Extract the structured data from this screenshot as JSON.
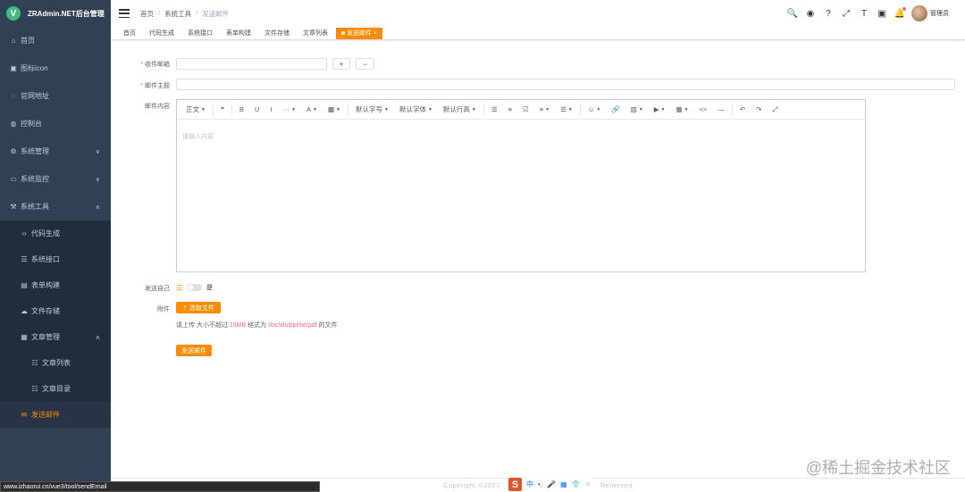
{
  "app": {
    "logo_letter": "V",
    "title": "ZRAdmin.NET后台管理"
  },
  "sidebar": {
    "items": [
      {
        "icon": "⌂",
        "label": "首页"
      },
      {
        "icon": "▣",
        "label": "图标icon"
      },
      {
        "icon": "◌",
        "label": "官网地址"
      },
      {
        "icon": "◍",
        "label": "控制台"
      },
      {
        "icon": "⚙",
        "label": "系统管理",
        "chevron": "∨"
      },
      {
        "icon": "▭",
        "label": "系统监控",
        "chevron": "∨"
      },
      {
        "icon": "⚒",
        "label": "系统工具",
        "chevron": "∧"
      }
    ],
    "tools_sub": [
      {
        "icon": "‹›",
        "label": "代码生成"
      },
      {
        "icon": "☰",
        "label": "系统接口"
      },
      {
        "icon": "▤",
        "label": "表单构建"
      },
      {
        "icon": "☁",
        "label": "文件存储"
      },
      {
        "icon": "▦",
        "label": "文章管理",
        "chevron": "∧"
      }
    ],
    "article_sub": [
      {
        "icon": "☷",
        "label": "文章列表"
      },
      {
        "icon": "☷",
        "label": "文章目录"
      }
    ],
    "active": {
      "icon": "✉",
      "label": "发送邮件"
    }
  },
  "header": {
    "breadcrumb": [
      "首页",
      "系统工具",
      "发送邮件"
    ],
    "separator": "/",
    "icons": [
      "🔍",
      "◉",
      "?",
      "⤢",
      "T",
      "▣",
      "🔔"
    ],
    "username": "管理员"
  },
  "tags": [
    "首页",
    "代码生成",
    "系统接口",
    "表单构建",
    "文件存储",
    "文章列表"
  ],
  "active_tag": "发送邮件",
  "active_tag_close": "×",
  "form": {
    "to_label": "收件邮箱",
    "add_label": "+",
    "remove_label": "−",
    "subject_label": "邮件主题",
    "content_label": "邮件内容",
    "editor_placeholder": "请输入内容",
    "send_self_label": "发送自己",
    "send_self_icon": "☰",
    "send_self_value": "是",
    "attach_label": "附件",
    "upload_label": "⇡ 选取文件",
    "tip_prefix": "请上传 大小不超过 ",
    "tip_size": "15MB",
    "tip_mid": " 格式为 ",
    "tip_types": "doc/xls/ppt/txt/pdf",
    "tip_suffix": " 的文件",
    "send_label": "发送邮件"
  },
  "toolbar": [
    {
      "label": "正文",
      "caret": true
    },
    {
      "sep": true
    },
    {
      "label": "❝"
    },
    {
      "sep": true
    },
    {
      "label": "B"
    },
    {
      "label": "U"
    },
    {
      "label": "I"
    },
    {
      "label": "···",
      "caret": true
    },
    {
      "label": "A",
      "caret": true
    },
    {
      "label": "▩",
      "caret": true
    },
    {
      "sep": true
    },
    {
      "label": "默认字号",
      "caret": true
    },
    {
      "label": "默认字体",
      "caret": true
    },
    {
      "label": "默认行高",
      "caret": true
    },
    {
      "sep": true
    },
    {
      "label": "☰"
    },
    {
      "label": "≡"
    },
    {
      "label": "☑"
    },
    {
      "label": "≡",
      "caret": true
    },
    {
      "label": "☰",
      "caret": true
    },
    {
      "sep": true
    },
    {
      "label": "☺",
      "caret": true
    },
    {
      "label": "🔗"
    },
    {
      "label": "▨",
      "caret": true
    },
    {
      "label": "▶",
      "caret": true
    },
    {
      "label": "▦",
      "caret": true
    },
    {
      "label": "<>"
    },
    {
      "label": "―"
    },
    {
      "sep": true
    },
    {
      "label": "↶"
    },
    {
      "label": "↷"
    },
    {
      "label": "⤢"
    }
  ],
  "footer": {
    "copyright": "Copyright ©2022",
    "reserved": "Reserved"
  },
  "ime": {
    "logo": "S",
    "items": [
      "中",
      "•,",
      "🎤",
      "▦",
      "👕",
      "⁘"
    ]
  },
  "status_url": "www.izhaorui.cn/vue3/tool/sendEmail",
  "watermark": "@稀土掘金技术社区"
}
